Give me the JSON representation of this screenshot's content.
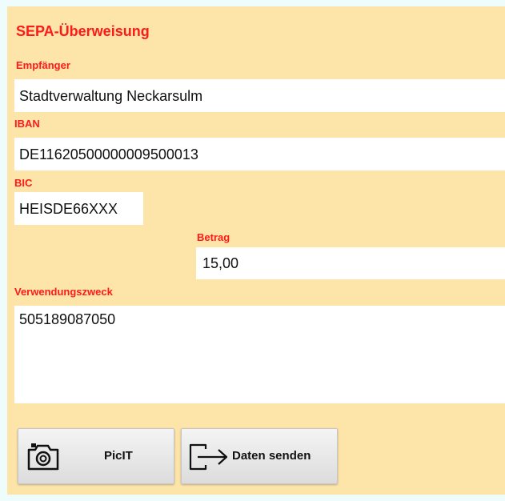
{
  "form": {
    "title": "SEPA-Überweisung",
    "recipient": {
      "label": "Empfänger",
      "value": "Stadtverwaltung Neckarsulm"
    },
    "iban": {
      "label": "IBAN",
      "value": "DE11620500000009500013"
    },
    "bic": {
      "label": "BIC",
      "value": "HEISDE66XXX"
    },
    "amount": {
      "label": "Betrag",
      "value": "15,00"
    },
    "purpose": {
      "label": "Verwendungszweck",
      "value": "505189087050"
    }
  },
  "buttons": {
    "picit": {
      "label": "PicIT",
      "icon": "camera-icon"
    },
    "send": {
      "label": "Daten senden",
      "icon": "export-arrow-icon"
    }
  },
  "colors": {
    "panel_background": "#fde4a8",
    "page_background": "#eefcfc",
    "label_red": "#ff1a1a"
  }
}
